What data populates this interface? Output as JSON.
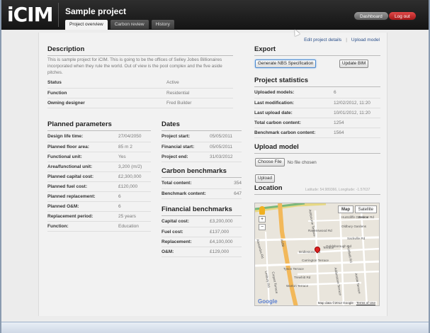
{
  "app": {
    "logo": "iCIM",
    "project_title": "Sample project"
  },
  "tabs": [
    {
      "label": "Project overview",
      "active": true
    },
    {
      "label": "Carbon review",
      "active": false
    },
    {
      "label": "History",
      "active": false
    }
  ],
  "header_buttons": {
    "dashboard": "Dashboard",
    "logout": "Log out"
  },
  "sublinks": {
    "edit": "Edit project details",
    "upload": "Upload model",
    "separator": "|"
  },
  "description": {
    "heading": "Description",
    "text": "This is sample project for iCIM. This is going to be the offices of Selley Jobes Billionaires incorporated when they rule the world. Out of view is the pool complex and the five aside pitches.",
    "rows": [
      {
        "key": "Status",
        "value": "Active"
      },
      {
        "key": "Function",
        "value": "Residential"
      },
      {
        "key": "Owning designer",
        "value": "Fred Builder"
      }
    ]
  },
  "planned": {
    "heading": "Planned parameters",
    "rows": [
      {
        "key": "Design life time:",
        "value": "27/04/2050"
      },
      {
        "key": "Planned floor area:",
        "value": "85 m 2"
      },
      {
        "key": "Functional unit:",
        "value": "Yes"
      },
      {
        "key": "Area/functional unit:",
        "value": "3,200 (m/2)"
      },
      {
        "key": "Planned capital cost:",
        "value": "£2,300,000"
      },
      {
        "key": "Planned fuel cost:",
        "value": "£120,000"
      },
      {
        "key": "Planned replacement:",
        "value": "6"
      },
      {
        "key": "Planned O&M:",
        "value": "6"
      },
      {
        "key": "Replacement period:",
        "value": "25 years"
      },
      {
        "key": "Function:",
        "value": "Education"
      }
    ]
  },
  "dates": {
    "heading": "Dates",
    "rows": [
      {
        "key": "Project start:",
        "value": "05/05/2011"
      },
      {
        "key": "Financial start:",
        "value": "05/05/2011"
      },
      {
        "key": "Project end:",
        "value": "31/03/2012"
      }
    ]
  },
  "carbon": {
    "heading": "Carbon benchmarks",
    "rows": [
      {
        "key": "Total content:",
        "value": "354"
      },
      {
        "key": "Benchmark content:",
        "value": "647"
      }
    ]
  },
  "financial": {
    "heading": "Financial benchmarks",
    "rows": [
      {
        "key": "Capital cost:",
        "value": "£3,200,000"
      },
      {
        "key": "Fuel cost:",
        "value": "£137,000"
      },
      {
        "key": "Replacement:",
        "value": "£4,100,000"
      },
      {
        "key": "O&M:",
        "value": "£129,000"
      }
    ]
  },
  "export": {
    "heading": "Export",
    "nbs_button": "Generate NBS Specification",
    "bim_button": "Update BIM"
  },
  "stats": {
    "heading": "Project statistics",
    "rows": [
      {
        "key": "Uploaded models:",
        "value": "6"
      },
      {
        "key": "Last modification:",
        "value": "12/02/2012, 11:20"
      },
      {
        "key": "Last upload date:",
        "value": "10/01/2012, 11:20"
      },
      {
        "key": "Total carbon content:",
        "value": "1254"
      },
      {
        "key": "Benchmark carbon content:",
        "value": "1564"
      }
    ]
  },
  "upload": {
    "heading": "Upload model",
    "choose_label": "Choose File",
    "no_file": "No file chosen",
    "upload_label": "Upload"
  },
  "location": {
    "heading": "Location",
    "latlng": "Latitude: 54.989366, Longitude: -1.57637",
    "map_toggle": "Map",
    "sat_toggle": "Satellite",
    "zoom_in": "+",
    "zoom_out": "−",
    "google": "Google",
    "credit": "Map data ©2012 Google ·",
    "terms": "Terms of Use",
    "streets": {
      "rd_a": "Ashbourne Terrace",
      "rd_b": "Huntcliffe Gardens",
      "rd_c": "Redcar Rd",
      "rd_d": "Oldbury Gardens",
      "rd_e": "Ravenswood Rd",
      "rd_f": "Sackville Rd",
      "rd_g": "Alexandra Rd",
      "rd_h": "Goldsborough Rd",
      "rd_i": "Bridlestone Rd",
      "rd_j": "Terrace",
      "rd_k": "Carrington Terrace",
      "rd_l": "Tyson Terrace",
      "rd_m": "Trewhitt Rd",
      "rd_n": "Warton Terrace",
      "rd_o": "A188",
      "rd_p": "Ashfield Rd",
      "rd_q": "Lesbury Rd",
      "rd_r": "Adderstone Terrace",
      "rd_s": "Coquet Terrace",
      "rd_t": "Amble Terrace"
    }
  }
}
